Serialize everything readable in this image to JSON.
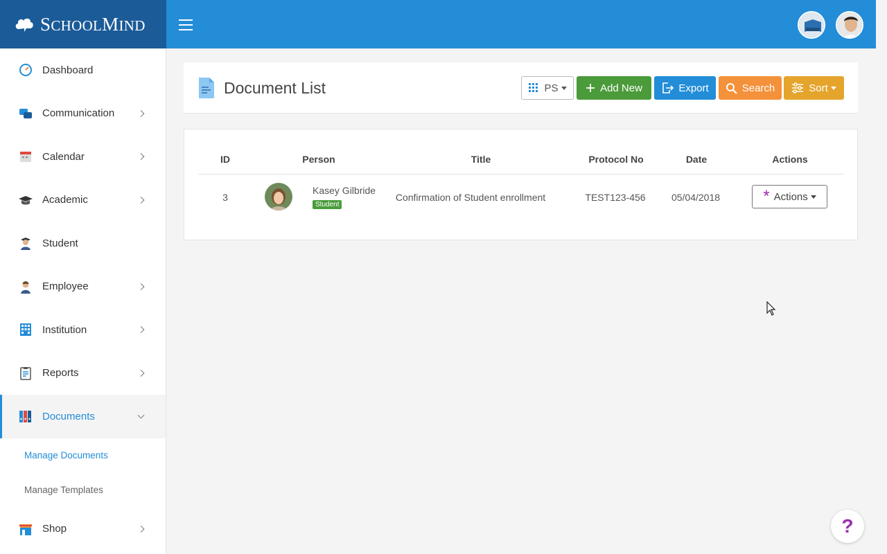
{
  "brand": {
    "name_big_1": "S",
    "name_small_1": "CHOOL",
    "name_big_2": "M",
    "name_small_2": "IND"
  },
  "sidebar": {
    "items": [
      {
        "label": "Dashboard"
      },
      {
        "label": "Communication"
      },
      {
        "label": "Calendar"
      },
      {
        "label": "Academic"
      },
      {
        "label": "Student"
      },
      {
        "label": "Employee"
      },
      {
        "label": "Institution"
      },
      {
        "label": "Reports"
      },
      {
        "label": "Documents"
      },
      {
        "label": "Shop"
      }
    ],
    "sub_items": [
      {
        "label": "Manage Documents"
      },
      {
        "label": "Manage Templates"
      }
    ]
  },
  "header": {
    "title": "Document List",
    "ps_label": "PS",
    "add_label": "Add New",
    "export_label": "Export",
    "search_label": "Search",
    "sort_label": "Sort"
  },
  "table": {
    "columns": [
      "ID",
      "Person",
      "Title",
      "Protocol No",
      "Date",
      "Actions"
    ],
    "rows": [
      {
        "id": "3",
        "person": "Kasey Gilbride",
        "badge": "Student",
        "title": "Confirmation of Student enrollment",
        "protocol": "TEST123-456",
        "date": "05/04/2018",
        "actions": "Actions"
      }
    ]
  },
  "help": {
    "label": "?"
  },
  "colors": {
    "brand": "#1b5b98",
    "topbar": "#238dd8",
    "add": "#4b9b3b",
    "export": "#238dd8",
    "search": "#f4913b",
    "sort": "#e5a42b",
    "accent": "#9b2fae"
  }
}
